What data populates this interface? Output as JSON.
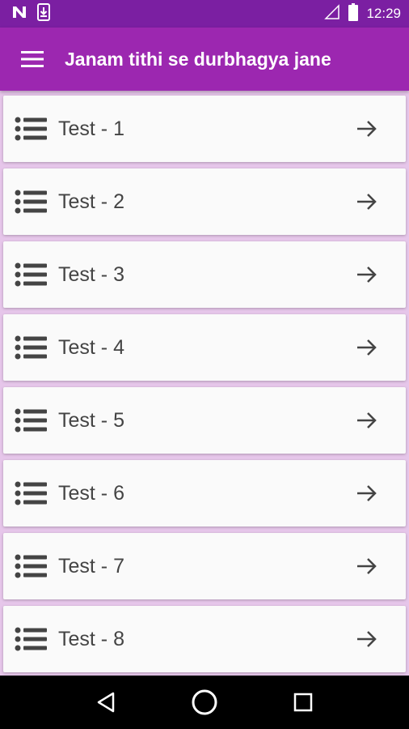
{
  "status_bar": {
    "time": "12:29",
    "icons": [
      "n-notification-icon",
      "download-icon",
      "signal-icon",
      "battery-icon"
    ]
  },
  "app_bar": {
    "title": "Janam tithi se durbhagya jane",
    "menu_icon": "hamburger-menu-icon",
    "background": "#9c27b0"
  },
  "tests": [
    {
      "label": "Test - 1"
    },
    {
      "label": "Test - 2"
    },
    {
      "label": "Test - 3"
    },
    {
      "label": "Test - 4"
    },
    {
      "label": "Test - 5"
    },
    {
      "label": "Test - 6"
    },
    {
      "label": "Test - 7"
    },
    {
      "label": "Test - 8"
    }
  ],
  "nav_bar": {
    "buttons": [
      "back-icon",
      "home-icon",
      "recents-icon"
    ]
  }
}
